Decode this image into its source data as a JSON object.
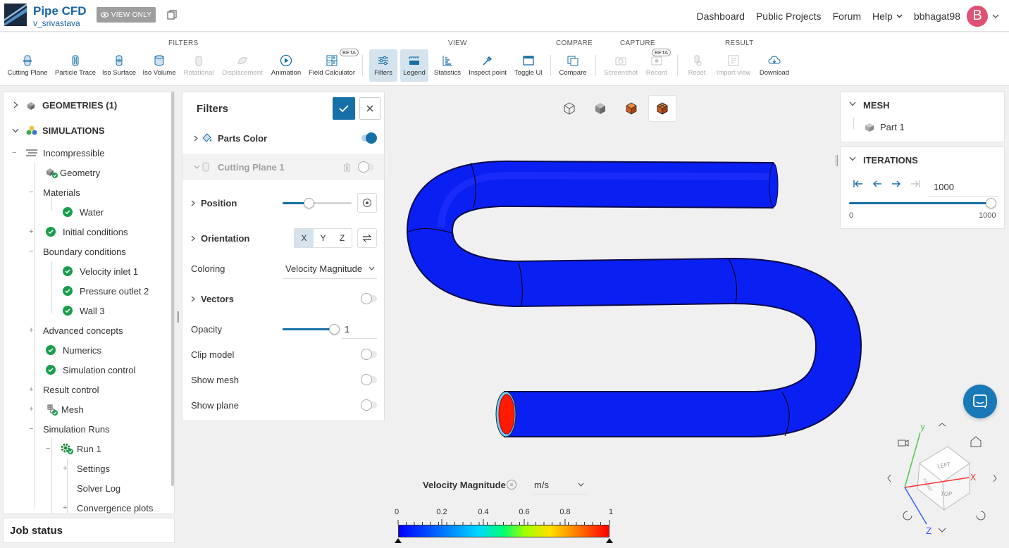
{
  "header": {
    "title": "Pipe CFD",
    "user_sub": "v_srivastava",
    "view_only": "VIEW ONLY",
    "nav": [
      "Dashboard",
      "Public Projects",
      "Forum"
    ],
    "help": "Help",
    "username": "bbhagat98",
    "avatar_letter": "B",
    "avatar_color": "#e05274"
  },
  "toolbar": {
    "groups": {
      "filters": "FILTERS",
      "view": "VIEW",
      "compare": "COMPARE",
      "capture": "CAPTURE",
      "result": "RESULT"
    },
    "tools": {
      "cutting_plane": "Cutting Plane",
      "particle_trace": "Particle Trace",
      "iso_surface": "Iso Surface",
      "iso_volume": "Iso Volume",
      "rotational": "Rotational",
      "displacement": "Displacement",
      "animation": "Animation",
      "field_calculator": "Field Calculator",
      "filters": "Filters",
      "legend": "Legend",
      "statistics": "Statistics",
      "inspect_point": "Inspect point",
      "toggle_ui": "Toggle UI",
      "compare": "Compare",
      "screenshot": "Screenshot",
      "record": "Record",
      "reset": "Reset",
      "import_view": "Import view",
      "download": "Download"
    },
    "beta": "BETA"
  },
  "tree": {
    "geometries": "GEOMETRIES (1)",
    "simulations": "SIMULATIONS",
    "incompressible": "Incompressible",
    "geometry": "Geometry",
    "materials": "Materials",
    "water": "Water",
    "initial_conditions": "Initial conditions",
    "boundary_conditions": "Boundary conditions",
    "velocity_inlet": "Velocity inlet 1",
    "pressure_outlet": "Pressure outlet 2",
    "wall": "Wall 3",
    "advanced_concepts": "Advanced concepts",
    "numerics": "Numerics",
    "simulation_control": "Simulation control",
    "result_control": "Result control",
    "mesh": "Mesh",
    "simulation_runs": "Simulation Runs",
    "run": "Run 1",
    "settings": "Settings",
    "solver_log": "Solver Log",
    "convergence_plots": "Convergence plots"
  },
  "job_status": "Job status",
  "filters_panel": {
    "title": "Filters",
    "parts_color": "Parts Color",
    "cutting_plane": "Cutting Plane 1",
    "position": "Position",
    "position_value": 0.38,
    "orientation": "Orientation",
    "axes": [
      "X",
      "Y",
      "Z"
    ],
    "selected_axis": "X",
    "coloring": "Coloring",
    "coloring_value": "Velocity Magnitude",
    "vectors": "Vectors",
    "opacity": "Opacity",
    "opacity_value": "1",
    "clip_model": "Clip model",
    "show_mesh": "Show mesh",
    "show_plane": "Show plane"
  },
  "mesh_panel": {
    "title": "MESH",
    "part": "Part 1"
  },
  "iterations_panel": {
    "title": "ITERATIONS",
    "value": "1000",
    "min": "0",
    "max": "1000"
  },
  "legend": {
    "title": "Velocity Magnitude",
    "unit": "m/s",
    "ticks": [
      "0",
      "0.2",
      "0.4",
      "0.6",
      "0.8",
      "1"
    ]
  },
  "orientation": {
    "y": "y",
    "x": "X",
    "z": "Z",
    "left": "LEFT",
    "top": "TOP",
    "front": "FRONT"
  },
  "colors": {
    "accent": "#1670a8",
    "pipe": "#0a1ff2",
    "pipe_inlet": "#ff1a00",
    "check": "#1a9e4e"
  }
}
